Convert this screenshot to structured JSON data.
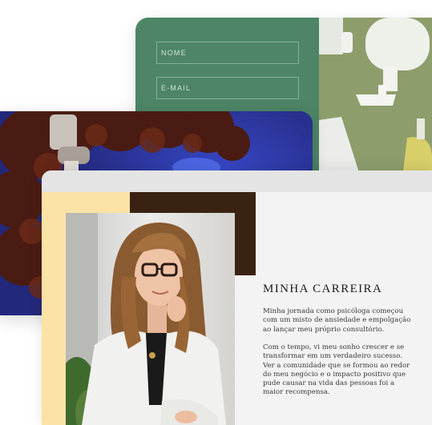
{
  "form": {
    "name_placeholder": "NOME",
    "email_placeholder": "E-MAIL"
  },
  "about": {
    "title": "MINHA CARREIRA",
    "paragraph_1": "Minha jornada como psicóloga começou com um misto de ansiedade e empolgação ao lançar meu próprio consultório.",
    "paragraph_2": "Com o tempo, vi meu sonho crescer e se transformar em um verdadeiro sucesso. Ver a comunidade que se formou ao redor do meu negócio e o impacto positivo que pude causar na vida das pessoas foi a maior recompensa."
  },
  "colors": {
    "form_green": "#4d8566",
    "accent_yellow": "#fbe3a6",
    "accent_brown": "#3a2212",
    "photo_blue": "#2a2f88"
  }
}
